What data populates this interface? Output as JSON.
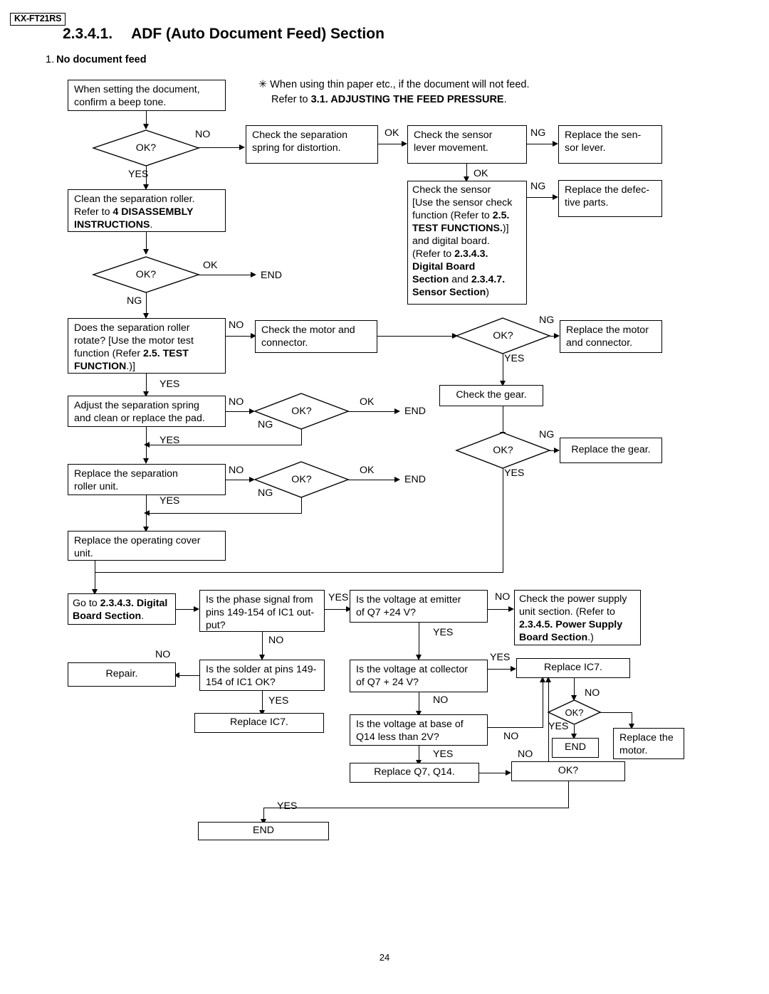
{
  "header": {
    "model_tag": "KX-FT21RS",
    "section_number": "2.3.4.1.",
    "section_title": "ADF (Auto Document Feed) Section",
    "subsection_index": "1.",
    "subsection_title": "No document feed",
    "page_number": "24"
  },
  "note": {
    "line1": "✳ When using thin paper etc., if the document will not feed.",
    "line2_prefix": "Refer to ",
    "line2_bold": "3.1. ADJUSTING THE FEED PRESSURE",
    "line2_suffix": "."
  },
  "boxes": {
    "b_start": "When setting the document,\nconfirm a beep tone.",
    "b_clean_roller_l1": "Clean the separation roller.",
    "b_clean_roller_l2a": "Refer to ",
    "b_clean_roller_l2b": "4 DISASSEMBLY",
    "b_clean_roller_l3a": "INSTRUCTIONS",
    "b_clean_roller_l3b": ".",
    "b_check_spring": "Check the separation\nspring for distortion.",
    "b_check_sensor_lever": "Check the sensor\nlever movement.",
    "b_replace_sensor_lever": "Replace the sen-\nsor lever.",
    "b_replace_defective": "Replace the defec-\ntive parts.",
    "b_check_sensor_1": "Check the sensor",
    "b_check_sensor_2": "[Use the sensor check",
    "b_check_sensor_3a": " function (Refer to ",
    "b_check_sensor_3b": "2.5.",
    "b_check_sensor_4a": " TEST FUNCTIONS.",
    "b_check_sensor_4b": ")]",
    "b_check_sensor_5": "and digital board.",
    "b_check_sensor_6a": "(Refer to ",
    "b_check_sensor_6b": "2.3.4.3.",
    "b_check_sensor_7": "Digital Board",
    "b_check_sensor_8a": "Section",
    "b_check_sensor_8b": " and ",
    "b_check_sensor_8c": "2.3.4.7.",
    "b_check_sensor_9a": "Sensor Section",
    "b_check_sensor_9b": ")",
    "b_roller_rotate_1": "Does the separation roller",
    "b_roller_rotate_2": "rotate? [Use the motor test",
    "b_roller_rotate_3a": "function (Refer ",
    "b_roller_rotate_3b": "2.5. TEST",
    "b_roller_rotate_4a": "FUNCTION",
    "b_roller_rotate_4b": ".)]",
    "b_check_motor": "Check the motor and\nconnector.",
    "b_replace_motor_conn": "Replace the motor\nand connector.",
    "b_check_gear": "Check the gear.",
    "b_replace_gear": "Replace the gear.",
    "b_adjust_spring": "Adjust the separation spring\nand clean or replace the pad.",
    "b_replace_roller_unit": "Replace the separation\nroller unit.",
    "b_replace_cover_unit": "Replace the operating cover\nunit.",
    "b_goto_digital_1a": "Go to ",
    "b_goto_digital_1b": "2.3.4.3. Digital",
    "b_goto_digital_2a": "Board Section",
    "b_goto_digital_2b": ".",
    "b_phase_signal": "Is the phase signal from\npins 149-154 of IC1 out-\nput?",
    "b_solder_ok": "Is the solder at pins 149-\n154 of IC1 OK?",
    "b_repair": "Repair.",
    "b_replace_ic7_left": "Replace IC7.",
    "b_volt_emitter": "Is the voltage at emitter\nof Q7 +24 V?",
    "b_volt_collector": "Is the voltage at collector\nof Q7 + 24 V?",
    "b_volt_base": "Is the voltage at base of\nQ14 less than 2V?",
    "b_replace_q7_q14": "Replace Q7, Q14.",
    "b_check_psu_1": "Check the power supply",
    "b_check_psu_2": "unit section. (Refer to",
    "b_check_psu_3": "2.3.4.5. Power Supply",
    "b_check_psu_4a": "Board Section",
    "b_check_psu_4b": ".)",
    "b_replace_ic7_right": "Replace IC7.",
    "b_replace_motor": "Replace the\nmotor.",
    "b_end_small": "END",
    "b_ok_rect": "OK?",
    "b_end_final": "END"
  },
  "diamonds": {
    "d1": "OK?",
    "d2": "OK?",
    "d3": "OK?",
    "d4": "OK?",
    "d5": "OK?",
    "d6": "OK?",
    "d7": "OK?",
    "d8": "OK?"
  },
  "terminals": {
    "end_1": "END",
    "end_2": "END",
    "end_3": "END"
  },
  "edge_labels": {
    "no_1": "NO",
    "yes_1": "YES",
    "ok_1": "OK",
    "ng_1": "NG",
    "ok_2": "OK",
    "ng_2": "NG",
    "ok_3": "OK",
    "ng_3": "NG",
    "no_2": "NO",
    "ng_4": "NG",
    "yes_2": "YES",
    "yes_3": "YES",
    "no_3": "NO",
    "ok_4": "OK",
    "ng_5": "NG",
    "yes_4": "YES",
    "no_4": "NO",
    "ok_5": "OK",
    "ng_6": "NG",
    "yes_5": "YES",
    "ng_7": "NG",
    "yes_6": "YES",
    "yes_7": "YES",
    "no_5": "NO",
    "no_6": "NO",
    "no_7": "NO",
    "yes_8": "YES",
    "yes_9": "YES",
    "no_8": "NO",
    "no_9": "NO",
    "yes_10": "YES",
    "no_10": "NO",
    "yes_11": "YES",
    "no_11": "NO",
    "yes_12": "YES",
    "no_12": "NO",
    "yes_13": "YES"
  }
}
